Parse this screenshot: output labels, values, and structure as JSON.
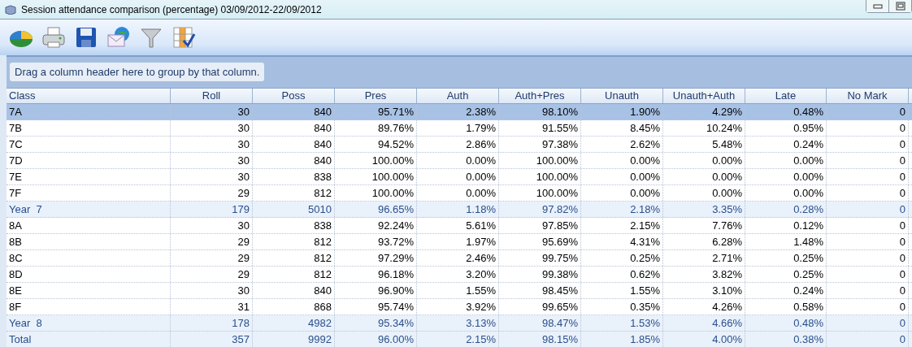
{
  "window": {
    "title": "Session attendance comparison (percentage) 03/09/2012-22/09/2012"
  },
  "group_panel": {
    "hint": "Drag a column header here to group by that column."
  },
  "table": {
    "columns": [
      "Class",
      "Roll",
      "Poss",
      "Pres",
      "Auth",
      "Auth+Pres",
      "Unauth",
      "Unauth+Auth",
      "Late",
      "No Mark"
    ],
    "rows": [
      {
        "kind": "class",
        "selected": true,
        "cells": [
          "7A",
          "30",
          "840",
          "95.71%",
          "2.38%",
          "98.10%",
          "1.90%",
          "4.29%",
          "0.48%",
          "0"
        ]
      },
      {
        "kind": "class",
        "selected": false,
        "cells": [
          "7B",
          "30",
          "840",
          "89.76%",
          "1.79%",
          "91.55%",
          "8.45%",
          "10.24%",
          "0.95%",
          "0"
        ]
      },
      {
        "kind": "class",
        "selected": false,
        "cells": [
          "7C",
          "30",
          "840",
          "94.52%",
          "2.86%",
          "97.38%",
          "2.62%",
          "5.48%",
          "0.24%",
          "0"
        ]
      },
      {
        "kind": "class",
        "selected": false,
        "cells": [
          "7D",
          "30",
          "840",
          "100.00%",
          "0.00%",
          "100.00%",
          "0.00%",
          "0.00%",
          "0.00%",
          "0"
        ]
      },
      {
        "kind": "class",
        "selected": false,
        "cells": [
          "7E",
          "30",
          "838",
          "100.00%",
          "0.00%",
          "100.00%",
          "0.00%",
          "0.00%",
          "0.00%",
          "0"
        ]
      },
      {
        "kind": "class",
        "selected": false,
        "cells": [
          "7F",
          "29",
          "812",
          "100.00%",
          "0.00%",
          "100.00%",
          "0.00%",
          "0.00%",
          "0.00%",
          "0"
        ]
      },
      {
        "kind": "subtotal",
        "selected": false,
        "cells": [
          "Year  7",
          "179",
          "5010",
          "96.65%",
          "1.18%",
          "97.82%",
          "2.18%",
          "3.35%",
          "0.28%",
          "0"
        ]
      },
      {
        "kind": "class",
        "selected": false,
        "cells": [
          "8A",
          "30",
          "838",
          "92.24%",
          "5.61%",
          "97.85%",
          "2.15%",
          "7.76%",
          "0.12%",
          "0"
        ]
      },
      {
        "kind": "class",
        "selected": false,
        "cells": [
          "8B",
          "29",
          "812",
          "93.72%",
          "1.97%",
          "95.69%",
          "4.31%",
          "6.28%",
          "1.48%",
          "0"
        ]
      },
      {
        "kind": "class",
        "selected": false,
        "cells": [
          "8C",
          "29",
          "812",
          "97.29%",
          "2.46%",
          "99.75%",
          "0.25%",
          "2.71%",
          "0.25%",
          "0"
        ]
      },
      {
        "kind": "class",
        "selected": false,
        "cells": [
          "8D",
          "29",
          "812",
          "96.18%",
          "3.20%",
          "99.38%",
          "0.62%",
          "3.82%",
          "0.25%",
          "0"
        ]
      },
      {
        "kind": "class",
        "selected": false,
        "cells": [
          "8E",
          "30",
          "840",
          "96.90%",
          "1.55%",
          "98.45%",
          "1.55%",
          "3.10%",
          "0.24%",
          "0"
        ]
      },
      {
        "kind": "class",
        "selected": false,
        "cells": [
          "8F",
          "31",
          "868",
          "95.74%",
          "3.92%",
          "99.65%",
          "0.35%",
          "4.26%",
          "0.58%",
          "0"
        ]
      },
      {
        "kind": "subtotal",
        "selected": false,
        "cells": [
          "Year  8",
          "178",
          "4982",
          "95.34%",
          "3.13%",
          "98.47%",
          "1.53%",
          "4.66%",
          "0.48%",
          "0"
        ]
      },
      {
        "kind": "total",
        "selected": false,
        "cells": [
          "Total",
          "357",
          "9992",
          "96.00%",
          "2.15%",
          "98.15%",
          "1.85%",
          "4.00%",
          "0.38%",
          "0"
        ]
      }
    ]
  }
}
